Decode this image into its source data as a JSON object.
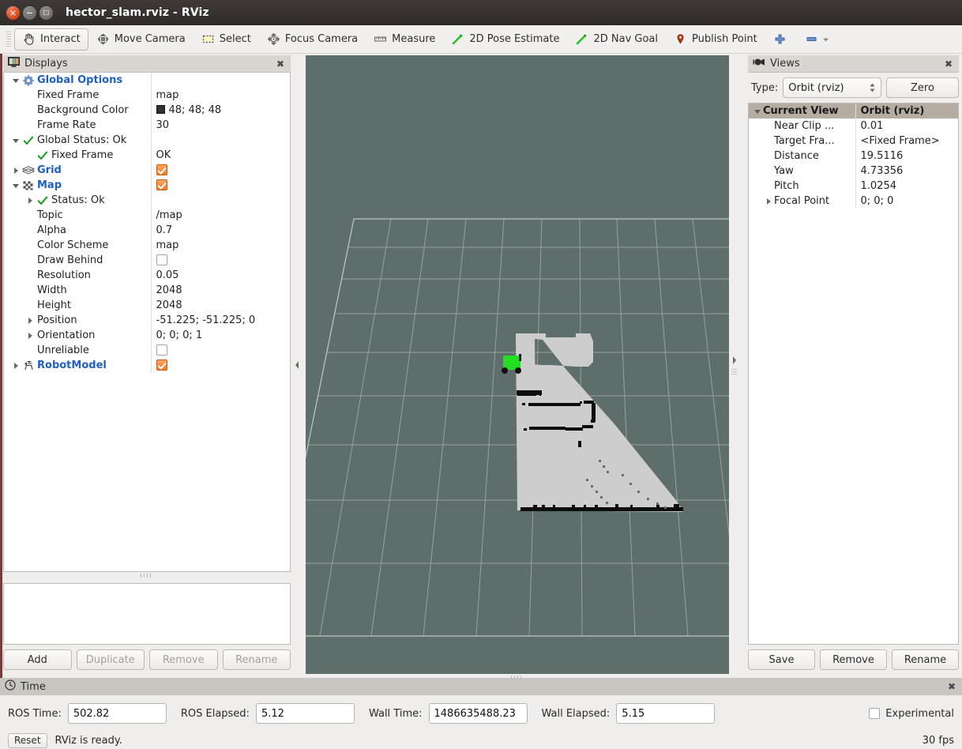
{
  "window": {
    "title": "hector_slam.rviz - RViz",
    "close_glyph": "×",
    "min_glyph": "−",
    "max_glyph": "□"
  },
  "toolbar": {
    "items": [
      {
        "label": "Interact",
        "icon": "hand-cursor-icon",
        "active": true
      },
      {
        "label": "Move Camera",
        "icon": "move-camera-icon",
        "active": false
      },
      {
        "label": "Select",
        "icon": "select-rectangle-icon",
        "active": false
      },
      {
        "label": "Focus Camera",
        "icon": "focus-camera-icon",
        "active": false
      },
      {
        "label": "Measure",
        "icon": "ruler-icon",
        "active": false
      },
      {
        "label": "2D Pose Estimate",
        "icon": "pose-arrow-icon",
        "active": false
      },
      {
        "label": "2D Nav Goal",
        "icon": "nav-goal-arrow-icon",
        "active": false
      },
      {
        "label": "Publish Point",
        "icon": "map-pin-icon",
        "active": false
      },
      {
        "label": "",
        "icon": "add-tool-plus-icon",
        "active": false
      },
      {
        "label": "",
        "icon": "remove-tool-minus-icon",
        "active": false
      }
    ]
  },
  "displays": {
    "title": "Displays",
    "icon": "displays-monitor-icon",
    "close_glyph": "✖",
    "rows": [
      {
        "indent": 0,
        "arrow": "down",
        "icon": "gear-icon",
        "label": "Global Options",
        "bold": true,
        "value": "",
        "value_type": "text"
      },
      {
        "indent": 1,
        "arrow": "none",
        "icon": "none",
        "label": "Fixed Frame",
        "bold": false,
        "value": "map",
        "value_type": "text"
      },
      {
        "indent": 1,
        "arrow": "none",
        "icon": "none",
        "label": "Background Color",
        "bold": false,
        "value": "48; 48; 48",
        "value_type": "color",
        "swatch": "#303030"
      },
      {
        "indent": 1,
        "arrow": "none",
        "icon": "none",
        "label": "Frame Rate",
        "bold": false,
        "value": "30",
        "value_type": "text"
      },
      {
        "indent": 0,
        "arrow": "down",
        "icon": "check-icon",
        "label": "Global Status: Ok",
        "bold": false,
        "value": "",
        "value_type": "text"
      },
      {
        "indent": 1,
        "arrow": "none",
        "icon": "check-icon",
        "label": "Fixed Frame",
        "bold": false,
        "value": "OK",
        "value_type": "text"
      },
      {
        "indent": 0,
        "arrow": "right",
        "icon": "grid-icon",
        "label": "Grid",
        "bold": true,
        "value": "",
        "value_type": "checked"
      },
      {
        "indent": 0,
        "arrow": "down",
        "icon": "map-icon",
        "label": "Map",
        "bold": true,
        "value": "",
        "value_type": "checked"
      },
      {
        "indent": 1,
        "arrow": "right",
        "icon": "check-icon",
        "label": "Status: Ok",
        "bold": false,
        "value": "",
        "value_type": "text"
      },
      {
        "indent": 1,
        "arrow": "none",
        "icon": "none",
        "label": "Topic",
        "bold": false,
        "value": "/map",
        "value_type": "text"
      },
      {
        "indent": 1,
        "arrow": "none",
        "icon": "none",
        "label": "Alpha",
        "bold": false,
        "value": "0.7",
        "value_type": "text"
      },
      {
        "indent": 1,
        "arrow": "none",
        "icon": "none",
        "label": "Color Scheme",
        "bold": false,
        "value": "map",
        "value_type": "text"
      },
      {
        "indent": 1,
        "arrow": "none",
        "icon": "none",
        "label": "Draw Behind",
        "bold": false,
        "value": "",
        "value_type": "unchecked"
      },
      {
        "indent": 1,
        "arrow": "none",
        "icon": "none",
        "label": "Resolution",
        "bold": false,
        "value": "0.05",
        "value_type": "text"
      },
      {
        "indent": 1,
        "arrow": "none",
        "icon": "none",
        "label": "Width",
        "bold": false,
        "value": "2048",
        "value_type": "text"
      },
      {
        "indent": 1,
        "arrow": "none",
        "icon": "none",
        "label": "Height",
        "bold": false,
        "value": "2048",
        "value_type": "text"
      },
      {
        "indent": 1,
        "arrow": "right",
        "icon": "none",
        "label": "Position",
        "bold": false,
        "value": "-51.225; -51.225; 0",
        "value_type": "text"
      },
      {
        "indent": 1,
        "arrow": "right",
        "icon": "none",
        "label": "Orientation",
        "bold": false,
        "value": "0; 0; 0; 1",
        "value_type": "text"
      },
      {
        "indent": 1,
        "arrow": "none",
        "icon": "none",
        "label": "Unreliable",
        "bold": false,
        "value": "",
        "value_type": "unchecked"
      },
      {
        "indent": 0,
        "arrow": "right",
        "icon": "robot-icon",
        "label": "RobotModel",
        "bold": true,
        "value": "",
        "value_type": "checked"
      }
    ],
    "buttons": [
      {
        "label": "Add",
        "enabled": true
      },
      {
        "label": "Duplicate",
        "enabled": false
      },
      {
        "label": "Remove",
        "enabled": false
      },
      {
        "label": "Rename",
        "enabled": false
      }
    ]
  },
  "views": {
    "title": "Views",
    "icon": "camera-icon",
    "close_glyph": "✖",
    "type_label": "Type:",
    "type_value": "Orbit (rviz)",
    "zero_label": "Zero",
    "header": {
      "name": "Current View",
      "value": "Orbit (rviz)"
    },
    "rows": [
      {
        "label": "Near Clip ...",
        "value": "0.01",
        "arrow": "none"
      },
      {
        "label": "Target Fra...",
        "value": "<Fixed Frame>",
        "arrow": "none"
      },
      {
        "label": "Distance",
        "value": "19.5116",
        "arrow": "none"
      },
      {
        "label": "Yaw",
        "value": "4.73356",
        "arrow": "none"
      },
      {
        "label": "Pitch",
        "value": "1.0254",
        "arrow": "none"
      },
      {
        "label": "Focal Point",
        "value": "0; 0; 0",
        "arrow": "right"
      }
    ],
    "buttons": [
      {
        "label": "Save",
        "enabled": true
      },
      {
        "label": "Remove",
        "enabled": true
      },
      {
        "label": "Rename",
        "enabled": true
      }
    ]
  },
  "time": {
    "title": "Time",
    "icon": "clock-icon",
    "close_glyph": "✖",
    "fields": [
      {
        "label": "ROS Time:",
        "value": "502.82"
      },
      {
        "label": "ROS Elapsed:",
        "value": "5.12"
      },
      {
        "label": "Wall Time:",
        "value": "1486635488.23"
      },
      {
        "label": "Wall Elapsed:",
        "value": "5.15"
      }
    ],
    "experimental_label": "Experimental",
    "experimental_checked": false
  },
  "statusbar": {
    "reset_label": "Reset",
    "message": "RViz is ready.",
    "fps": "30 fps"
  },
  "viewport": {
    "background_color": "#5d6e6b",
    "grid_color": "#b9c4c1",
    "map_free_color": "#cccccc",
    "map_occupied_color": "#101010",
    "robot_color": "#22dd22"
  }
}
